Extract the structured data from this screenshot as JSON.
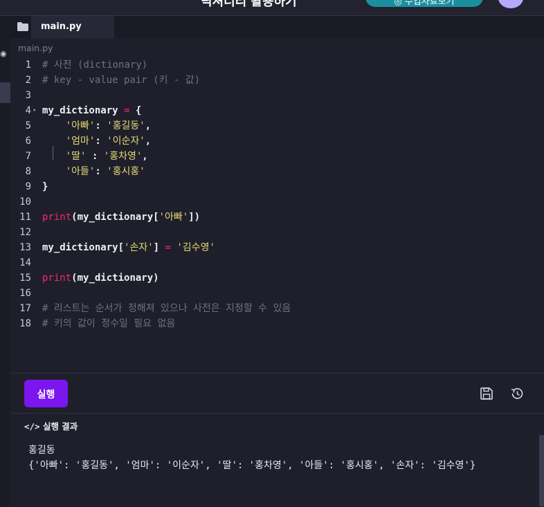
{
  "header": {
    "title": "딕셔너리 활용하기",
    "pill_text": "◎ 수업자료보기"
  },
  "editor": {
    "tab_label": "main.py",
    "breadcrumb": "main.py",
    "lines": [
      {
        "n": "1",
        "tokens": [
          {
            "t": "# 사전 (dictionary)",
            "c": "c-comment"
          }
        ]
      },
      {
        "n": "2",
        "tokens": [
          {
            "t": "# key - value pair (키 - 값)",
            "c": "c-comment"
          }
        ]
      },
      {
        "n": "3",
        "tokens": []
      },
      {
        "n": "4",
        "fold": true,
        "tokens": [
          {
            "t": "my_dictionary ",
            "c": ""
          },
          {
            "t": "=",
            "c": "c-op"
          },
          {
            "t": " {",
            "c": ""
          }
        ]
      },
      {
        "n": "5",
        "tokens": [
          {
            "t": "    ",
            "c": ""
          },
          {
            "t": "'아빠'",
            "c": "c-str"
          },
          {
            "t": ": ",
            "c": ""
          },
          {
            "t": "'홍길동'",
            "c": "c-str"
          },
          {
            "t": ",",
            "c": ""
          }
        ]
      },
      {
        "n": "6",
        "tokens": [
          {
            "t": "    ",
            "c": ""
          },
          {
            "t": "'엄마'",
            "c": "c-str"
          },
          {
            "t": ": ",
            "c": ""
          },
          {
            "t": "'이순자'",
            "c": "c-str"
          },
          {
            "t": ",",
            "c": ""
          }
        ]
      },
      {
        "n": "7",
        "tokens": [
          {
            "t": "    ",
            "c": ""
          },
          {
            "t": "'딸'",
            "c": "c-str"
          },
          {
            "t": " : ",
            "c": ""
          },
          {
            "t": "'홍차영'",
            "c": "c-str"
          },
          {
            "t": ",",
            "c": ""
          }
        ]
      },
      {
        "n": "8",
        "tokens": [
          {
            "t": "    ",
            "c": ""
          },
          {
            "t": "'아들'",
            "c": "c-str"
          },
          {
            "t": ": ",
            "c": ""
          },
          {
            "t": "'홍시홍'",
            "c": "c-str"
          }
        ]
      },
      {
        "n": "9",
        "tokens": [
          {
            "t": "}",
            "c": ""
          }
        ]
      },
      {
        "n": "10",
        "tokens": []
      },
      {
        "n": "11",
        "tokens": [
          {
            "t": "print",
            "c": "c-fn"
          },
          {
            "t": "(my_dictionary[",
            "c": ""
          },
          {
            "t": "'아빠'",
            "c": "c-str"
          },
          {
            "t": "])",
            "c": ""
          }
        ]
      },
      {
        "n": "12",
        "tokens": []
      },
      {
        "n": "13",
        "tokens": [
          {
            "t": "my_dictionary[",
            "c": ""
          },
          {
            "t": "'손자'",
            "c": "c-str"
          },
          {
            "t": "] ",
            "c": ""
          },
          {
            "t": "=",
            "c": "c-op"
          },
          {
            "t": " ",
            "c": ""
          },
          {
            "t": "'김수영'",
            "c": "c-str"
          }
        ]
      },
      {
        "n": "14",
        "tokens": []
      },
      {
        "n": "15",
        "tokens": [
          {
            "t": "print",
            "c": "c-fn"
          },
          {
            "t": "(my_dictionary)",
            "c": ""
          }
        ]
      },
      {
        "n": "16",
        "tokens": []
      },
      {
        "n": "17",
        "tokens": [
          {
            "t": "# 리스트는 순서가 정해져 있으나 사전은 지정할 수 있음",
            "c": "c-comment"
          }
        ]
      },
      {
        "n": "18",
        "tokens": [
          {
            "t": "# 키의 값이 정수일 필요 없음",
            "c": "c-comment"
          }
        ]
      }
    ]
  },
  "toolbar": {
    "run_label": "실행",
    "save_icon": "save-icon",
    "history_icon": "history-icon"
  },
  "result": {
    "header_code": "</>",
    "header_label": "실행 결과",
    "output": [
      "홍길동",
      "{'아빠': '홍길동', '엄마': '이순자', '딸': '홍차영', '아들': '홍시홍', '손자': '김수영'}"
    ]
  },
  "colors": {
    "accent": "#7b16ee",
    "background": "#1e1f2b",
    "string": "#e6db74",
    "keyword": "#f92672",
    "comment": "#6f7186"
  }
}
